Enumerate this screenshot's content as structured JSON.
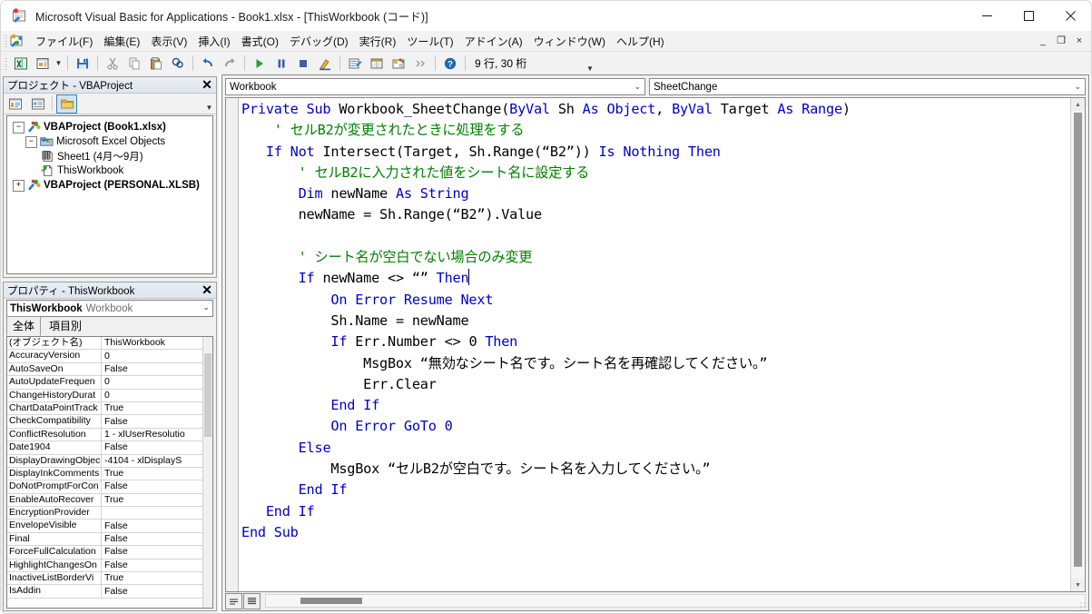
{
  "window": {
    "title": "Microsoft Visual Basic for Applications - Book1.xlsx - [ThisWorkbook (コード)]",
    "icon": "vba-app-icon",
    "controls": {
      "minimize": "—",
      "maximize": "☐",
      "close": "✕"
    },
    "mdi_controls": {
      "minimize": "_",
      "restore": "❐",
      "close": "×"
    }
  },
  "menubar": {
    "app_icon": "vba-menu-icon",
    "items": [
      {
        "label": "ファイル(F)",
        "accel": "F"
      },
      {
        "label": "編集(E)",
        "accel": "E"
      },
      {
        "label": "表示(V)",
        "accel": "V"
      },
      {
        "label": "挿入(I)",
        "accel": "I"
      },
      {
        "label": "書式(O)",
        "accel": "O"
      },
      {
        "label": "デバッグ(D)",
        "accel": "D"
      },
      {
        "label": "実行(R)",
        "accel": "R"
      },
      {
        "label": "ツール(T)",
        "accel": "T"
      },
      {
        "label": "アドイン(A)",
        "accel": "A"
      },
      {
        "label": "ウィンドウ(W)",
        "accel": "W"
      },
      {
        "label": "ヘルプ(H)",
        "accel": "H"
      }
    ]
  },
  "toolbar": {
    "status": "9 行, 30 桁",
    "overflow": "▼",
    "icons": [
      "view-excel-icon",
      "insert-userform-icon",
      "insert-dropdown-caret",
      "save-icon",
      "cut-icon",
      "copy-icon",
      "paste-icon",
      "find-icon",
      "undo-icon",
      "redo-icon",
      "run-icon",
      "break-icon",
      "reset-icon",
      "design-mode-icon",
      "project-explorer-icon",
      "properties-window-icon",
      "object-browser-icon",
      "toolbox-icon",
      "help-icon"
    ]
  },
  "project_pane": {
    "title": "プロジェクト - VBAProject",
    "close_label": "✕",
    "toolbar_icons": [
      "view-code-icon",
      "view-object-icon",
      "toggle-folders-icon"
    ],
    "toolbar_more": "▼",
    "tree": [
      {
        "level": 0,
        "expander": "−",
        "icon": "vbaproject-icon",
        "label": "VBAProject (Book1.xlsx)",
        "bold": true
      },
      {
        "level": 1,
        "expander": "−",
        "icon": "folder-icon",
        "label": "Microsoft Excel Objects",
        "bold": false
      },
      {
        "level": 2,
        "expander": "",
        "icon": "sheet-icon",
        "label": "Sheet1 (4月～9月)",
        "bold": false
      },
      {
        "level": 2,
        "expander": "",
        "icon": "workbook-icon",
        "label": "ThisWorkbook",
        "bold": false,
        "selected": true
      },
      {
        "level": 0,
        "expander": "+",
        "icon": "vbaproject-icon",
        "label": "VBAProject (PERSONAL.XLSB)",
        "bold": true
      }
    ]
  },
  "properties_pane": {
    "title": "プロパティ - ThisWorkbook",
    "close_label": "✕",
    "object_name": "ThisWorkbook",
    "object_type": "Workbook",
    "dropdown_arrow": "⌄",
    "tabs": [
      {
        "label": "全体",
        "active": true
      },
      {
        "label": "項目別",
        "active": false
      }
    ],
    "rows": [
      {
        "name": "(オブジェクト名)",
        "value": "ThisWorkbook"
      },
      {
        "name": "AccuracyVersion",
        "value": "0"
      },
      {
        "name": "AutoSaveOn",
        "value": "False"
      },
      {
        "name": "AutoUpdateFrequen",
        "value": "0"
      },
      {
        "name": "ChangeHistoryDurat",
        "value": "0"
      },
      {
        "name": "ChartDataPointTrack",
        "value": "True"
      },
      {
        "name": "CheckCompatibility",
        "value": "False"
      },
      {
        "name": "ConflictResolution",
        "value": "1 - xlUserResolutio"
      },
      {
        "name": "Date1904",
        "value": "False"
      },
      {
        "name": "DisplayDrawingObjec",
        "value": "-4104 - xlDisplayS"
      },
      {
        "name": "DisplayInkComments",
        "value": "True"
      },
      {
        "name": "DoNotPromptForCon",
        "value": "False"
      },
      {
        "name": "EnableAutoRecover",
        "value": "True"
      },
      {
        "name": "EncryptionProvider",
        "value": ""
      },
      {
        "name": "EnvelopeVisible",
        "value": "False"
      },
      {
        "name": "Final",
        "value": "False"
      },
      {
        "name": "ForceFullCalculation",
        "value": "False"
      },
      {
        "name": "HighlightChangesOn",
        "value": "False"
      },
      {
        "name": "InactiveListBorderVi",
        "value": "True"
      },
      {
        "name": "IsAddin",
        "value": "False"
      }
    ]
  },
  "code_window": {
    "object_dropdown": "Workbook",
    "procedure_dropdown": "SheetChange",
    "dropdown_arrow": "⌄",
    "bottom_buttons": [
      "procedure-view-button",
      "full-module-view-button"
    ],
    "colors": {
      "keyword": "#0000c8",
      "comment": "#008000",
      "plain": "#000000",
      "background": "#ffffff"
    },
    "lines": [
      {
        "indent": 0,
        "tokens": [
          {
            "t": "kw",
            "s": "Private Sub "
          },
          {
            "t": "pl",
            "s": "Workbook_SheetChange("
          },
          {
            "t": "kw",
            "s": "ByVal "
          },
          {
            "t": "pl",
            "s": "Sh "
          },
          {
            "t": "kw",
            "s": "As Object"
          },
          {
            "t": "pl",
            "s": ", "
          },
          {
            "t": "kw",
            "s": "ByVal "
          },
          {
            "t": "pl",
            "s": "Target "
          },
          {
            "t": "kw",
            "s": "As Range"
          },
          {
            "t": "pl",
            "s": ")"
          }
        ]
      },
      {
        "indent": 4,
        "tokens": [
          {
            "t": "cm",
            "s": "' セルB2が変更されたときに処理をする"
          }
        ]
      },
      {
        "indent": 3,
        "tokens": [
          {
            "t": "kw",
            "s": "If Not "
          },
          {
            "t": "pl",
            "s": "Intersect(Target, Sh.Range(“B2”)) "
          },
          {
            "t": "kw",
            "s": "Is Nothing Then"
          }
        ]
      },
      {
        "indent": 7,
        "tokens": [
          {
            "t": "cm",
            "s": "' セルB2に入力された値をシート名に設定する"
          }
        ]
      },
      {
        "indent": 7,
        "tokens": [
          {
            "t": "kw",
            "s": "Dim "
          },
          {
            "t": "pl",
            "s": "newName "
          },
          {
            "t": "kw",
            "s": "As String"
          }
        ]
      },
      {
        "indent": 7,
        "tokens": [
          {
            "t": "pl",
            "s": "newName = Sh.Range(“B2”).Value"
          }
        ]
      },
      {
        "indent": 0,
        "tokens": []
      },
      {
        "indent": 7,
        "tokens": [
          {
            "t": "cm",
            "s": "' シート名が空白でない場合のみ変更"
          }
        ]
      },
      {
        "indent": 7,
        "tokens": [
          {
            "t": "kw",
            "s": "If "
          },
          {
            "t": "pl",
            "s": "newName <> “” "
          },
          {
            "t": "kw",
            "s": "Then"
          }
        ],
        "caret": true
      },
      {
        "indent": 11,
        "tokens": [
          {
            "t": "kw",
            "s": "On Error Resume Next"
          }
        ]
      },
      {
        "indent": 11,
        "tokens": [
          {
            "t": "pl",
            "s": "Sh.Name = newName"
          }
        ]
      },
      {
        "indent": 11,
        "tokens": [
          {
            "t": "kw",
            "s": "If "
          },
          {
            "t": "pl",
            "s": "Err.Number <> 0 "
          },
          {
            "t": "kw",
            "s": "Then"
          }
        ]
      },
      {
        "indent": 15,
        "tokens": [
          {
            "t": "pl",
            "s": "MsgBox “無効なシート名です。シート名を再確認してください。”"
          }
        ]
      },
      {
        "indent": 15,
        "tokens": [
          {
            "t": "pl",
            "s": "Err.Clear"
          }
        ]
      },
      {
        "indent": 11,
        "tokens": [
          {
            "t": "kw",
            "s": "End If"
          }
        ]
      },
      {
        "indent": 11,
        "tokens": [
          {
            "t": "kw",
            "s": "On Error GoTo 0"
          }
        ]
      },
      {
        "indent": 7,
        "tokens": [
          {
            "t": "kw",
            "s": "Else"
          }
        ]
      },
      {
        "indent": 11,
        "tokens": [
          {
            "t": "pl",
            "s": "MsgBox “セルB2が空白です。シート名を入力してください。”"
          }
        ]
      },
      {
        "indent": 7,
        "tokens": [
          {
            "t": "kw",
            "s": "End If"
          }
        ]
      },
      {
        "indent": 3,
        "tokens": [
          {
            "t": "kw",
            "s": "End If"
          }
        ]
      },
      {
        "indent": 0,
        "tokens": [
          {
            "t": "kw",
            "s": "End Sub"
          }
        ]
      }
    ]
  }
}
